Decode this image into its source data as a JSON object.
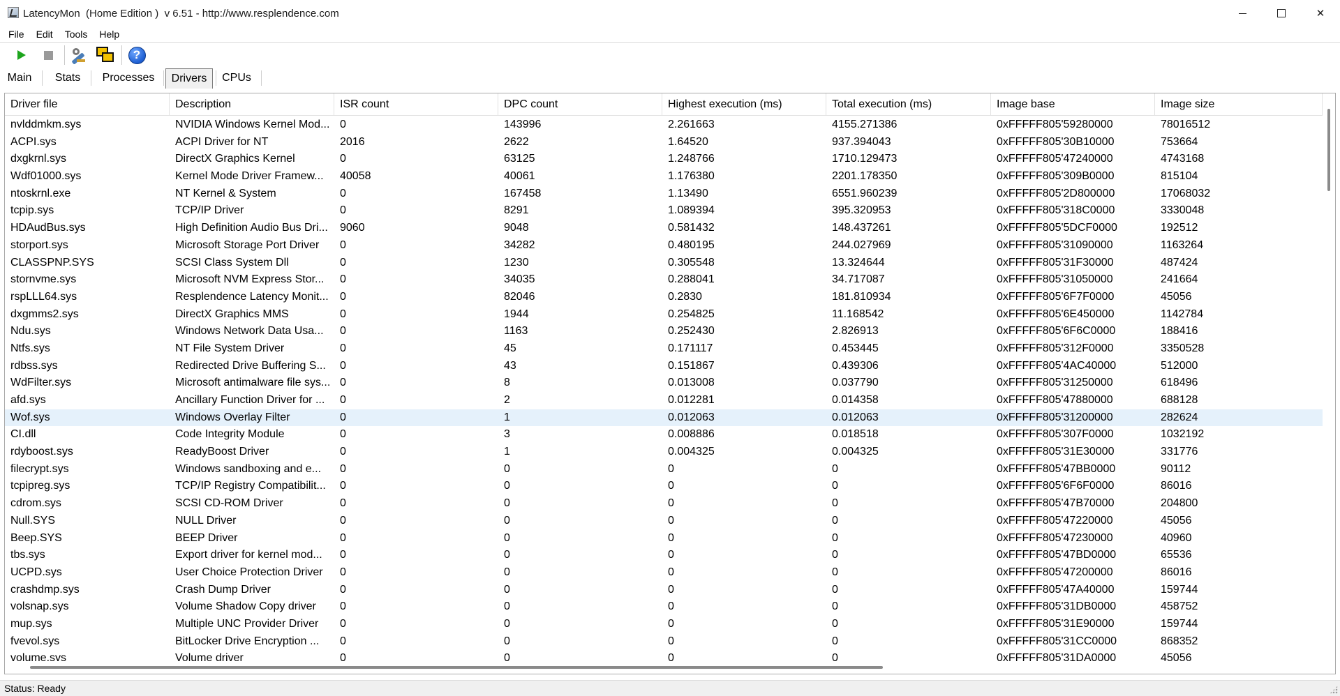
{
  "window": {
    "title": "LatencyMon  (Home Edition )  v 6.51 - http://www.resplendence.com"
  },
  "menu": [
    "File",
    "Edit",
    "Tools",
    "Help"
  ],
  "toolbar": {
    "icons": [
      "play-icon",
      "stop-icon",
      "tools-icon",
      "windows-icon",
      "help-icon"
    ]
  },
  "tabs": [
    {
      "label": "Main"
    },
    {
      "label": "Stats"
    },
    {
      "label": "Processes"
    },
    {
      "label": "Drivers",
      "active": true
    },
    {
      "label": "CPUs"
    }
  ],
  "table": {
    "columns": [
      "Driver file",
      "Description",
      "ISR count",
      "DPC count",
      "Highest execution (ms)",
      "Total execution (ms)",
      "Image base",
      "Image size"
    ],
    "selected_row": 17,
    "rows": [
      [
        "nvlddmkm.sys",
        "NVIDIA Windows Kernel Mod...",
        "0",
        "143996",
        "2.261663",
        "4155.271386",
        "0xFFFFF805'59280000",
        "78016512"
      ],
      [
        "ACPI.sys",
        "ACPI Driver for NT",
        "2016",
        "2622",
        "1.64520",
        "937.394043",
        "0xFFFFF805'30B10000",
        "753664"
      ],
      [
        "dxgkrnl.sys",
        "DirectX Graphics Kernel",
        "0",
        "63125",
        "1.248766",
        "1710.129473",
        "0xFFFFF805'47240000",
        "4743168"
      ],
      [
        "Wdf01000.sys",
        "Kernel Mode Driver Framew...",
        "40058",
        "40061",
        "1.176380",
        "2201.178350",
        "0xFFFFF805'309B0000",
        "815104"
      ],
      [
        "ntoskrnl.exe",
        "NT Kernel & System",
        "0",
        "167458",
        "1.13490",
        "6551.960239",
        "0xFFFFF805'2D800000",
        "17068032"
      ],
      [
        "tcpip.sys",
        "TCP/IP Driver",
        "0",
        "8291",
        "1.089394",
        "395.320953",
        "0xFFFFF805'318C0000",
        "3330048"
      ],
      [
        "HDAudBus.sys",
        "High Definition Audio Bus Dri...",
        "9060",
        "9048",
        "0.581432",
        "148.437261",
        "0xFFFFF805'5DCF0000",
        "192512"
      ],
      [
        "storport.sys",
        "Microsoft Storage Port Driver",
        "0",
        "34282",
        "0.480195",
        "244.027969",
        "0xFFFFF805'31090000",
        "1163264"
      ],
      [
        "CLASSPNP.SYS",
        "SCSI Class System Dll",
        "0",
        "1230",
        "0.305548",
        "13.324644",
        "0xFFFFF805'31F30000",
        "487424"
      ],
      [
        "stornvme.sys",
        "Microsoft NVM Express Stor...",
        "0",
        "34035",
        "0.288041",
        "34.717087",
        "0xFFFFF805'31050000",
        "241664"
      ],
      [
        "rspLLL64.sys",
        "Resplendence Latency Monit...",
        "0",
        "82046",
        "0.2830",
        "181.810934",
        "0xFFFFF805'6F7F0000",
        "45056"
      ],
      [
        "dxgmms2.sys",
        "DirectX Graphics MMS",
        "0",
        "1944",
        "0.254825",
        "11.168542",
        "0xFFFFF805'6E450000",
        "1142784"
      ],
      [
        "Ndu.sys",
        "Windows Network Data Usa...",
        "0",
        "1163",
        "0.252430",
        "2.826913",
        "0xFFFFF805'6F6C0000",
        "188416"
      ],
      [
        "Ntfs.sys",
        "NT File System Driver",
        "0",
        "45",
        "0.171117",
        "0.453445",
        "0xFFFFF805'312F0000",
        "3350528"
      ],
      [
        "rdbss.sys",
        "Redirected Drive Buffering S...",
        "0",
        "43",
        "0.151867",
        "0.439306",
        "0xFFFFF805'4AC40000",
        "512000"
      ],
      [
        "WdFilter.sys",
        "Microsoft antimalware file sys...",
        "0",
        "8",
        "0.013008",
        "0.037790",
        "0xFFFFF805'31250000",
        "618496"
      ],
      [
        "afd.sys",
        "Ancillary Function Driver for ...",
        "0",
        "2",
        "0.012281",
        "0.014358",
        "0xFFFFF805'47880000",
        "688128"
      ],
      [
        "Wof.sys",
        "Windows Overlay Filter",
        "0",
        "1",
        "0.012063",
        "0.012063",
        "0xFFFFF805'31200000",
        "282624"
      ],
      [
        "CI.dll",
        "Code Integrity Module",
        "0",
        "3",
        "0.008886",
        "0.018518",
        "0xFFFFF805'307F0000",
        "1032192"
      ],
      [
        "rdyboost.sys",
        "ReadyBoost Driver",
        "0",
        "1",
        "0.004325",
        "0.004325",
        "0xFFFFF805'31E30000",
        "331776"
      ],
      [
        "filecrypt.sys",
        "Windows sandboxing and e...",
        "0",
        "0",
        "0",
        "0",
        "0xFFFFF805'47BB0000",
        "90112"
      ],
      [
        "tcpipreg.sys",
        "TCP/IP Registry Compatibilit...",
        "0",
        "0",
        "0",
        "0",
        "0xFFFFF805'6F6F0000",
        "86016"
      ],
      [
        "cdrom.sys",
        "SCSI CD-ROM Driver",
        "0",
        "0",
        "0",
        "0",
        "0xFFFFF805'47B70000",
        "204800"
      ],
      [
        "Null.SYS",
        "NULL Driver",
        "0",
        "0",
        "0",
        "0",
        "0xFFFFF805'47220000",
        "45056"
      ],
      [
        "Beep.SYS",
        "BEEP Driver",
        "0",
        "0",
        "0",
        "0",
        "0xFFFFF805'47230000",
        "40960"
      ],
      [
        "tbs.sys",
        "Export driver for kernel mod...",
        "0",
        "0",
        "0",
        "0",
        "0xFFFFF805'47BD0000",
        "65536"
      ],
      [
        "UCPD.sys",
        "User Choice Protection Driver",
        "0",
        "0",
        "0",
        "0",
        "0xFFFFF805'47200000",
        "86016"
      ],
      [
        "crashdmp.sys",
        "Crash Dump Driver",
        "0",
        "0",
        "0",
        "0",
        "0xFFFFF805'47A40000",
        "159744"
      ],
      [
        "volsnap.sys",
        "Volume Shadow Copy driver",
        "0",
        "0",
        "0",
        "0",
        "0xFFFFF805'31DB0000",
        "458752"
      ],
      [
        "mup.sys",
        "Multiple UNC Provider Driver",
        "0",
        "0",
        "0",
        "0",
        "0xFFFFF805'31E90000",
        "159744"
      ],
      [
        "fvevol.sys",
        "BitLocker Drive Encryption ...",
        "0",
        "0",
        "0",
        "0",
        "0xFFFFF805'31CC0000",
        "868352"
      ],
      [
        "volume.sys",
        "Volume driver",
        "0",
        "0",
        "0",
        "0",
        "0xFFFFF805'31DA0000",
        "45056"
      ]
    ]
  },
  "status": "Status: Ready"
}
